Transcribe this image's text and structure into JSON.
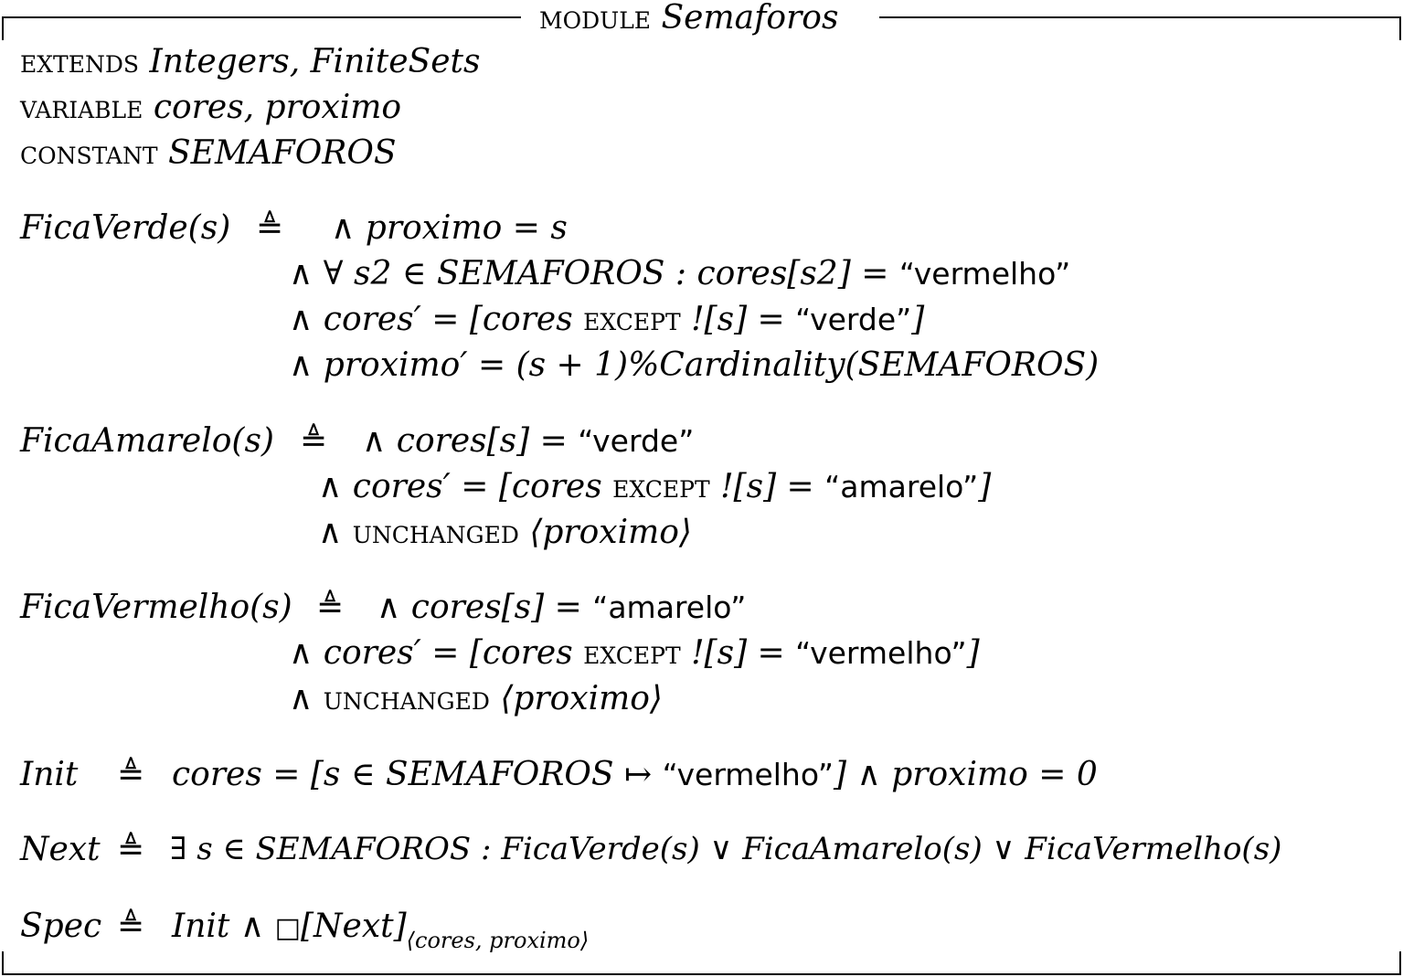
{
  "module": {
    "keyword": "module",
    "name": "Semaforos"
  },
  "header": {
    "extends_kw": "extends",
    "extends_list": "Integers, FiniteSets",
    "variable_kw": "variable",
    "variable_list": "cores, proximo",
    "constant_kw": "constant",
    "constant_list": "SEMAFOROS"
  },
  "fica_verde": {
    "name": "FicaVerde(s)",
    "def": "≜",
    "l1": "∧ proximo = s",
    "l2_a": "∧ ∀ s2   ∈ SEMAFOROS : cores[s2] = ",
    "l2_str": "“vermelho”",
    "l3_a": "∧ cores′ = [cores ",
    "l3_kw": "except",
    "l3_b": " ![s] = ",
    "l3_str": "“verde”",
    "l3_c": "]",
    "l4": "∧ proximo′ = (s + 1)%Cardinality(SEMAFOROS)"
  },
  "fica_amarelo": {
    "name": "FicaAmarelo(s)",
    "def": "≜",
    "l1_a": "∧ cores[s] = ",
    "l1_str": "“verde”",
    "l2_a": "∧ cores′ = [cores ",
    "l2_kw": "except",
    "l2_b": " ![s] = ",
    "l2_str": "“amarelo”",
    "l2_c": "]",
    "l3_kw": "∧ unchanged",
    "l3_b": " ⟨proximo⟩"
  },
  "fica_vermelho": {
    "name": "FicaVermelho(s)",
    "def": "≜",
    "l1_a": "∧ cores[s] = ",
    "l1_str": "“amarelo”",
    "l2_a": "∧ cores′ = [cores ",
    "l2_kw": "except",
    "l2_b": " ![s] = ",
    "l2_str": "“vermelho”",
    "l2_c": "]",
    "l3_kw": "∧ unchanged",
    "l3_b": " ⟨proximo⟩"
  },
  "init": {
    "name": "Init",
    "def": "≜",
    "body_a": "cores = [s ∈ SEMAFOROS ↦ ",
    "body_str": "“vermelho”",
    "body_b": "] ∧ proximo = 0"
  },
  "next": {
    "name": "Next",
    "def": "≜",
    "body": "∃ s ∈ SEMAFOROS : FicaVerde(s) ∨ FicaAmarelo(s) ∨ FicaVermelho(s)"
  },
  "spec": {
    "name": "Spec",
    "def": "≜",
    "body_a": "Init ∧ ",
    "box": "□",
    "body_b": "[Next]",
    "sub": "⟨cores, proximo⟩"
  }
}
